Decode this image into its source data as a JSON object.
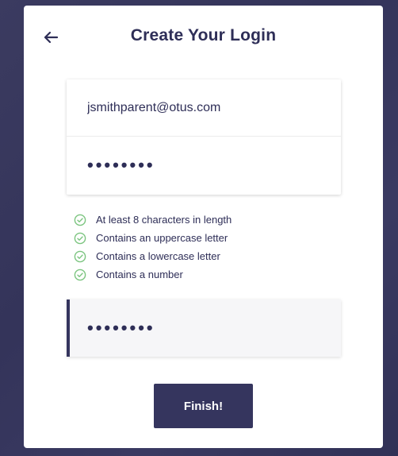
{
  "page": {
    "title": "Create Your Login"
  },
  "icons": {
    "back": "arrow-left-icon",
    "rule_check": "check-circle-icon"
  },
  "form": {
    "email_value": "jsmithparent@otus.com",
    "password_value": "••••••••",
    "confirm_password_value": "••••••••"
  },
  "requirements": [
    {
      "label": "At least 8 characters in length",
      "met": true
    },
    {
      "label": "Contains an uppercase letter",
      "met": true
    },
    {
      "label": "Contains a lowercase letter",
      "met": true
    },
    {
      "label": "Contains a number",
      "met": true
    }
  ],
  "buttons": {
    "finish_label": "Finish!"
  },
  "colors": {
    "brand": "#35355e",
    "check": "#7bc47f",
    "background": "#3a3a5e"
  }
}
